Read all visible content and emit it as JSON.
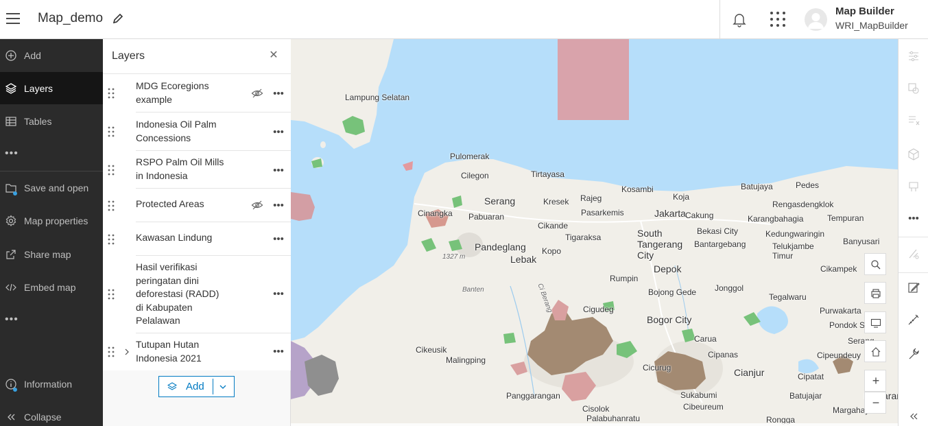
{
  "header": {
    "app_title": "Map_demo",
    "user_name": "Map Builder",
    "user_id": "WRI_MapBuilder"
  },
  "leftnav": {
    "items": [
      {
        "label": "Add",
        "icon": "add-circle-icon"
      },
      {
        "label": "Layers",
        "icon": "layers-icon",
        "active": true
      },
      {
        "label": "Tables",
        "icon": "table-icon"
      },
      {
        "label": "Save and open",
        "icon": "folder-icon"
      },
      {
        "label": "Map properties",
        "icon": "gear-icon"
      },
      {
        "label": "Share map",
        "icon": "share-icon"
      },
      {
        "label": "Embed map",
        "icon": "code-icon"
      },
      {
        "label": "Information",
        "icon": "info-icon"
      },
      {
        "label": "Collapse",
        "icon": "double-chevron-left-icon"
      }
    ],
    "more": "•••"
  },
  "panel": {
    "title": "Layers",
    "close": "✕",
    "layers": [
      {
        "name": "MDG Ecoregions example",
        "hidden": true
      },
      {
        "name": "Indonesia Oil Palm Concessions",
        "hidden": false
      },
      {
        "name": "RSPO Palm Oil Mills in Indonesia",
        "hidden": false
      },
      {
        "name": "Protected Areas",
        "hidden": true
      },
      {
        "name": "Kawasan Lindung",
        "hidden": false
      },
      {
        "name": "Hasil verifikasi peringatan dini deforestasi (RADD) di Kabupaten Pelalawan",
        "hidden": false
      },
      {
        "name": "Tutupan Hutan Indonesia 2021",
        "hidden": false,
        "group": true
      }
    ],
    "more_label": "•••",
    "add_label": "Add"
  },
  "map": {
    "places": [
      {
        "t": "Lampung Selatan"
      },
      {
        "t": "Pulomerak"
      },
      {
        "t": "Cilegon"
      },
      {
        "t": "Tirtayasa"
      },
      {
        "t": "Serang"
      },
      {
        "t": "Kresek"
      },
      {
        "t": "Rajeg"
      },
      {
        "t": "Kosambi"
      },
      {
        "t": "Batujaya"
      },
      {
        "t": "Pedes"
      },
      {
        "t": "Koja"
      },
      {
        "t": "Rengasdengklok"
      },
      {
        "t": "Cinangka"
      },
      {
        "t": "Pabuaran"
      },
      {
        "t": "Pasarkemis"
      },
      {
        "t": "Jakarta"
      },
      {
        "t": "Cakung"
      },
      {
        "t": "Karangbahagia"
      },
      {
        "t": "Tempuran"
      },
      {
        "t": "Cikande"
      },
      {
        "t": "Bekasi City"
      },
      {
        "t": "Pandeglang"
      },
      {
        "t": "Tigaraksa"
      },
      {
        "t": "South"
      },
      {
        "t": "Tangerang"
      },
      {
        "t": "City"
      },
      {
        "t": "Bantargebang"
      },
      {
        "t": "Kedungwaringin"
      },
      {
        "t": "Banyusari"
      },
      {
        "t": "Telukjambe"
      },
      {
        "t": "Timur"
      },
      {
        "t": "1327 m"
      },
      {
        "t": "Lebak"
      },
      {
        "t": "Kopo"
      },
      {
        "t": "Depok"
      },
      {
        "t": "Cikampek"
      },
      {
        "t": "Rumpin"
      },
      {
        "t": "Banten"
      },
      {
        "t": "Jonggol"
      },
      {
        "t": "Bojong Gede"
      },
      {
        "t": "Tegalwaru"
      },
      {
        "t": "Cigudeg"
      },
      {
        "t": "Purwakarta"
      },
      {
        "t": "Bogor City"
      },
      {
        "t": "Pondok Salam"
      },
      {
        "t": "Caruа"
      },
      {
        "t": "Cikeusik"
      },
      {
        "t": "Cipanas"
      },
      {
        "t": "Cipeundeuy"
      },
      {
        "t": "Malingping"
      },
      {
        "t": "Cianjur"
      },
      {
        "t": "Cipatat"
      },
      {
        "t": "Cicurug"
      },
      {
        "t": "Panggarangan"
      },
      {
        "t": "Sukabumi"
      },
      {
        "t": "Batujajar"
      },
      {
        "t": "Cisolok"
      },
      {
        "t": "Cibeureum"
      },
      {
        "t": "Palabuhanratu"
      },
      {
        "t": "Margahayu"
      },
      {
        "t": "Rongga"
      },
      {
        "t": "Serang"
      },
      {
        "t": "Ci Berang"
      },
      {
        "t": "Banjaran"
      }
    ],
    "zoom_in": "+",
    "zoom_out": "−"
  },
  "colors": {
    "nav_bg": "#2b2b2b",
    "nav_active": "#151515",
    "accent": "#007ac2",
    "water": "#b6defa",
    "land": "#f1efe9"
  }
}
